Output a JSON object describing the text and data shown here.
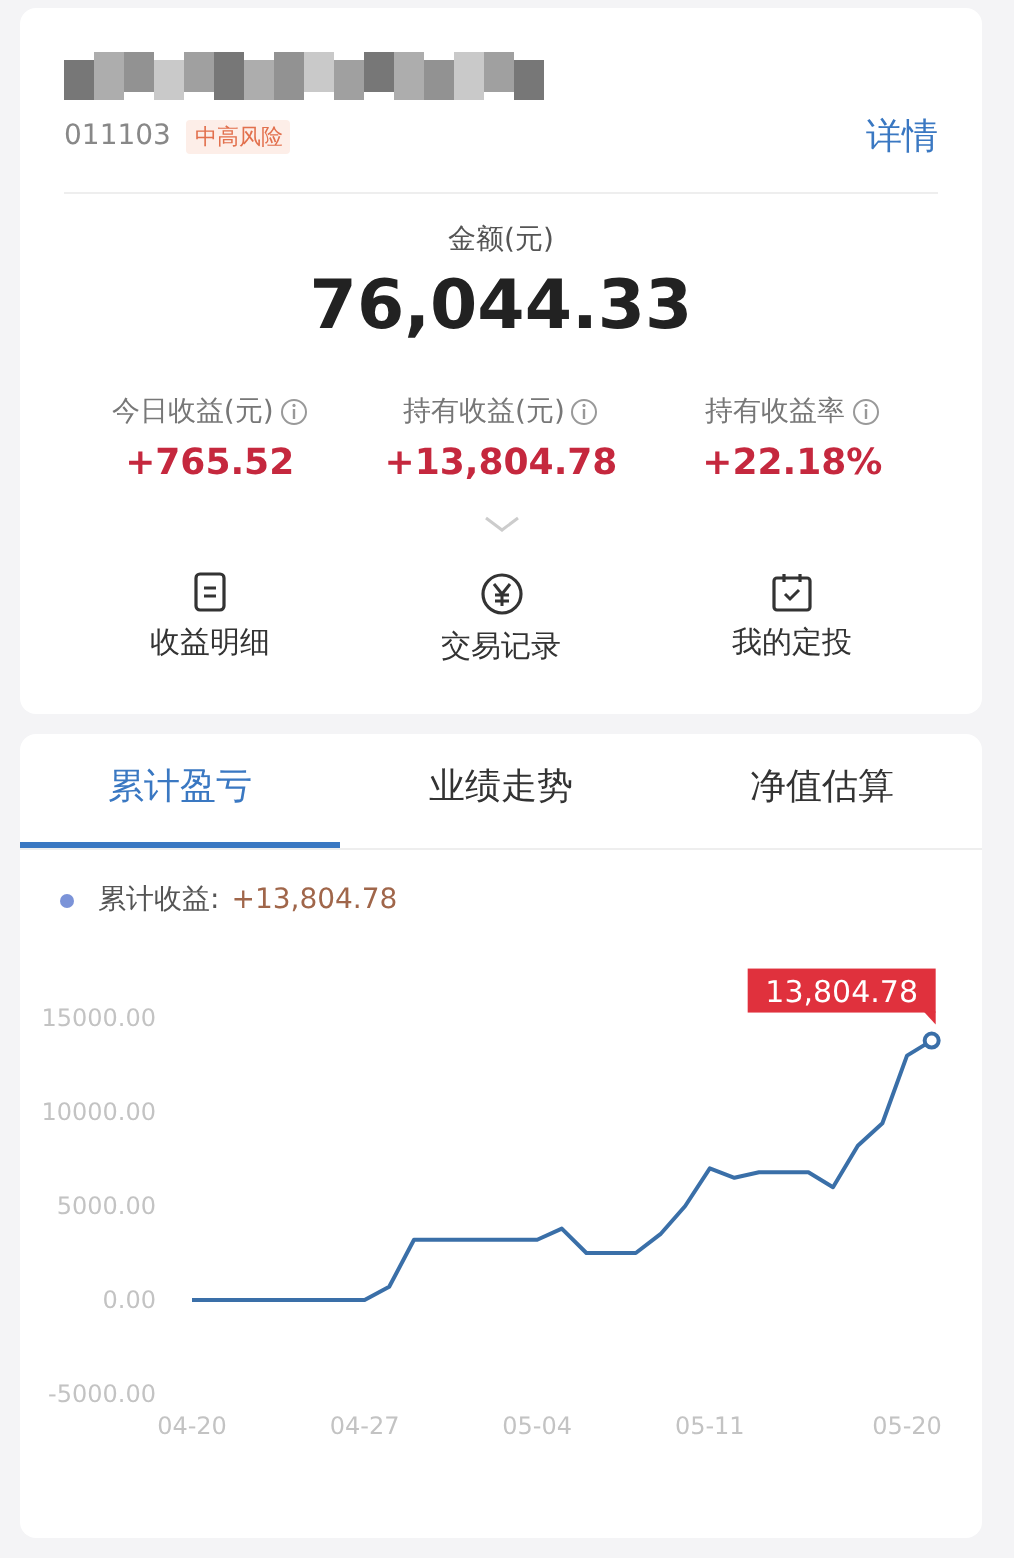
{
  "fund": {
    "code": "011103",
    "risk_tag": "中高风险",
    "details_link": "详情"
  },
  "amount": {
    "label": "金额(元)",
    "value": "76,044.33"
  },
  "stats": [
    {
      "label": "今日收益(元)",
      "value": "+765.52"
    },
    {
      "label": "持有收益(元)",
      "value": "+13,804.78"
    },
    {
      "label": "持有收益率",
      "value": "+22.18%"
    }
  ],
  "actions": [
    {
      "kind": "list",
      "label": "收益明细"
    },
    {
      "kind": "yuan",
      "label": "交易记录"
    },
    {
      "kind": "calendar",
      "label": "我的定投"
    }
  ],
  "tabs": [
    {
      "label": "累计盈亏",
      "selected": true
    },
    {
      "label": "业绩走势",
      "selected": false
    },
    {
      "label": "净值估算",
      "selected": false
    }
  ],
  "legend": {
    "value": "+13,804.78",
    "color": "#7b93d8"
  },
  "chart_data": {
    "type": "line",
    "categories": [
      "04-20",
      null,
      null,
      null,
      null,
      null,
      null,
      "04-27",
      null,
      null,
      null,
      null,
      null,
      null,
      "05-04",
      null,
      null,
      null,
      null,
      null,
      null,
      "05-11",
      null,
      null,
      null,
      null,
      null,
      null,
      null,
      "05-20",
      null
    ],
    "series": [
      {
        "name": "累计收益:",
        "color": "#3a6fa8",
        "values": [
          0,
          0,
          0,
          0,
          0,
          0,
          0,
          0,
          700,
          3200,
          3200,
          3200,
          3200,
          3200,
          3200,
          3800,
          2500,
          2500,
          2500,
          3500,
          5000,
          7000,
          6500,
          6800,
          6800,
          6800,
          6000,
          8200,
          9400,
          13000,
          13800
        ]
      }
    ],
    "ylim": [
      -5000,
      15000
    ],
    "yticks": [
      {
        "value": 15000,
        "label": "15000.00"
      },
      {
        "value": 10000,
        "label": "10000.00"
      },
      {
        "value": 5000,
        "label": "5000.00"
      },
      {
        "value": 0,
        "label": "0.00"
      },
      {
        "value": -5000,
        "label": "-5000.00"
      }
    ],
    "annotations": [
      "13,804.78"
    ]
  }
}
